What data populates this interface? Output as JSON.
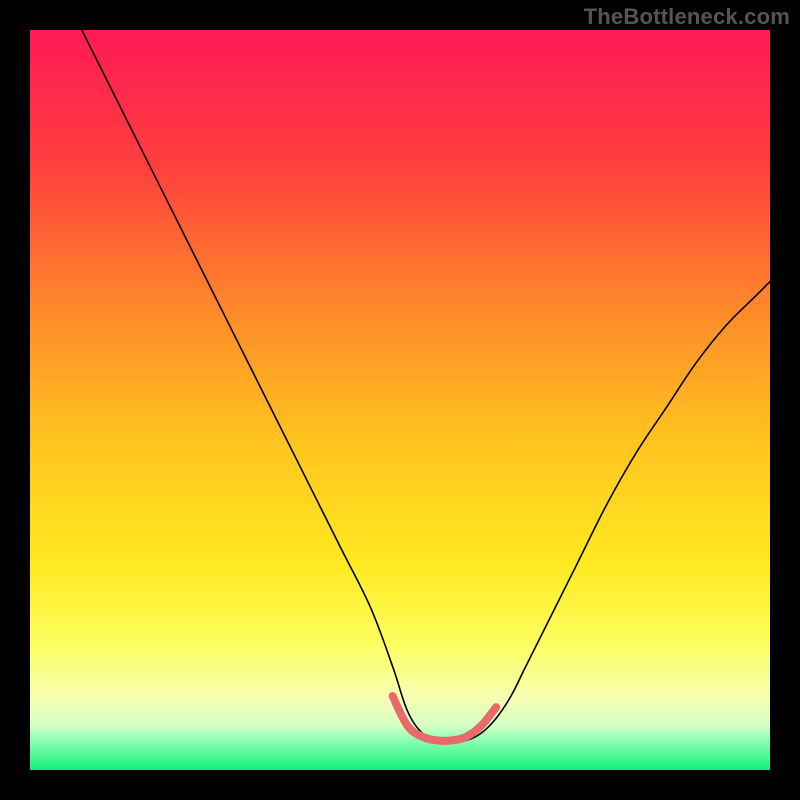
{
  "watermark": "TheBottleneck.com",
  "chart_data": {
    "type": "line",
    "title": "",
    "xlabel": "",
    "ylabel": "",
    "xlim": [
      0,
      100
    ],
    "ylim": [
      0,
      100
    ],
    "background_gradient_stops": [
      {
        "offset": 0,
        "color": "#ff1a55"
      },
      {
        "offset": 18,
        "color": "#ff3e3e"
      },
      {
        "offset": 38,
        "color": "#ff8a2a"
      },
      {
        "offset": 55,
        "color": "#ffc21f"
      },
      {
        "offset": 72,
        "color": "#ffe91f"
      },
      {
        "offset": 83,
        "color": "#fdff60"
      },
      {
        "offset": 90,
        "color": "#f7ffb0"
      },
      {
        "offset": 94,
        "color": "#d6ffc4"
      },
      {
        "offset": 96,
        "color": "#8cffb4"
      },
      {
        "offset": 100,
        "color": "#14f07a"
      }
    ],
    "series": [
      {
        "name": "bottleneck-curve",
        "x": [
          7,
          10,
          14,
          18,
          22,
          26,
          30,
          34,
          38,
          42,
          46,
          49,
          51,
          53,
          55,
          57,
          59,
          61,
          63,
          65,
          67,
          70,
          74,
          78,
          82,
          86,
          90,
          94,
          98,
          100
        ],
        "y": [
          100,
          94,
          86,
          78,
          70,
          62,
          54,
          46,
          38,
          30,
          22,
          14,
          8,
          5,
          4,
          3.8,
          4,
          5,
          7,
          10,
          14,
          20,
          28,
          36,
          43,
          49,
          55,
          60,
          64,
          66
        ],
        "stroke": "#000000",
        "stroke_width": 1.6
      },
      {
        "name": "valley-highlight",
        "x": [
          49,
          51,
          53,
          55,
          57,
          59,
          61,
          63
        ],
        "y": [
          10,
          6,
          4.5,
          4,
          4,
          4.5,
          6,
          8.5
        ],
        "stroke": "#e96a6a",
        "stroke_width": 8
      }
    ]
  }
}
